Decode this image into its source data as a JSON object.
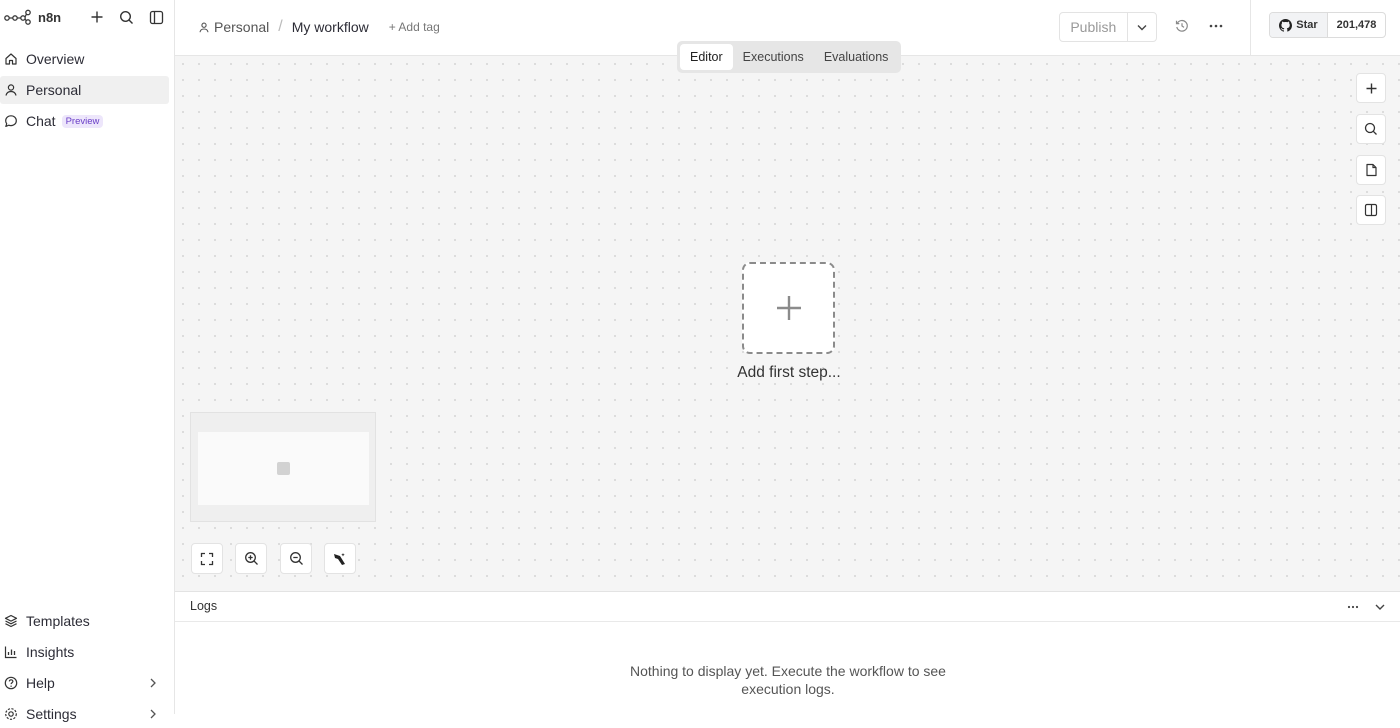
{
  "app": {
    "name": "n8n",
    "brand_color": "#ff6d5a"
  },
  "sidebar": {
    "top_icons": [
      "plus-icon",
      "search-icon",
      "panel-toggle-icon"
    ],
    "nav": [
      {
        "label": "Overview",
        "icon": "home-icon"
      },
      {
        "label": "Personal",
        "icon": "user-icon",
        "active": true
      },
      {
        "label": "Chat",
        "icon": "chat-icon",
        "badge": "Preview"
      }
    ],
    "bottom": [
      {
        "label": "Templates",
        "icon": "templates-icon"
      },
      {
        "label": "Insights",
        "icon": "insights-icon"
      },
      {
        "label": "Help",
        "icon": "help-icon"
      },
      {
        "label": "Settings",
        "icon": "settings-icon"
      }
    ]
  },
  "header": {
    "project": "Personal",
    "separator": "/",
    "workflow_name": "My workflow",
    "add_tag": "+ Add tag",
    "publish_label": "Publish",
    "github": {
      "star_label": "Star",
      "count": "201,478"
    }
  },
  "tabs": [
    {
      "label": "Editor",
      "active": true
    },
    {
      "label": "Executions"
    },
    {
      "label": "Evaluations"
    }
  ],
  "canvas": {
    "add_first_step_label": "Add first step...",
    "right_tools": [
      "plus-icon",
      "search-icon",
      "sticky-note-icon",
      "panel-icon"
    ],
    "zoom_controls": [
      "fit-view-icon",
      "zoom-in-icon",
      "zoom-out-icon",
      "tidy-up-icon"
    ]
  },
  "logs": {
    "title": "Logs",
    "empty_message": "Nothing to display yet. Execute the workflow to see execution logs."
  }
}
